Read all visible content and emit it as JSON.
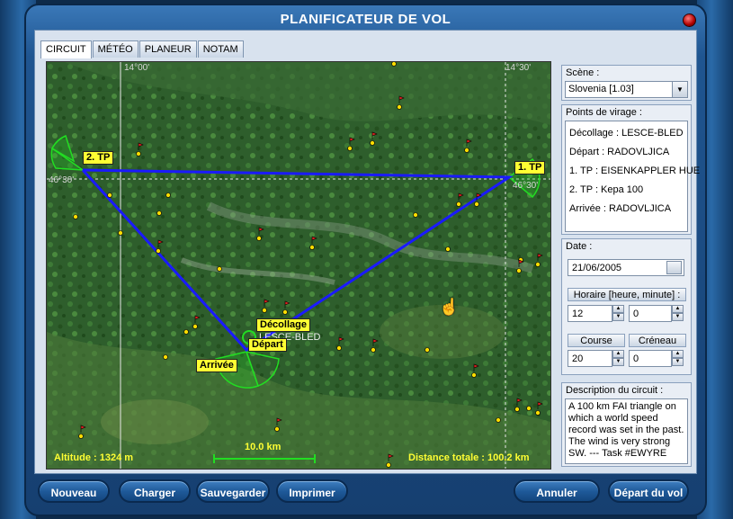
{
  "window": {
    "title": "PLANIFICATEUR DE VOL"
  },
  "tabs": [
    "CIRCUIT",
    "MÉTÉO",
    "PLANEUR",
    "NOTAM"
  ],
  "map": {
    "lon_left": "14°00'",
    "lon_right": "14°30'",
    "lat_left": "46°30'",
    "lat_right": "46°30'",
    "waypoint_2tp": "2. TP",
    "waypoint_1tp": "1. TP",
    "waypoint_takeoff": "Décollage",
    "waypoint_takeoff_name": "LESCE-BLED",
    "waypoint_start": "Départ",
    "waypoint_finish": "Arrivée",
    "altitude": "Altitude : 1324 m",
    "scale": "10.0 km",
    "total_distance": "Distance totale : 100.2 km",
    "route_color": "#1a1aff",
    "sector_color": "#22dd22"
  },
  "scene": {
    "label": "Scène :",
    "value": "Slovenia [1.03]"
  },
  "turnpoints": {
    "label": "Points de virage :",
    "items": [
      "Décollage : LESCE-BLED",
      "Départ : RADOVLJICA",
      "1. TP : EISENKAPPLER HUE",
      "2. TP : Kepa 100",
      "Arrivée : RADOVLJICA"
    ]
  },
  "date": {
    "label": "Date :",
    "value": "21/06/2005",
    "time_label": "Horaire [heure, minute] :",
    "hour": "12",
    "minute": "0",
    "course_label": "Course dans",
    "course_value": "20",
    "slot_label": "Créneau",
    "slot_value": "0"
  },
  "description": {
    "label": "Description du circuit :",
    "text": "A 100 km FAI triangle on which a world speed record was set in the past. The wind is very strong SW. --- Task #EWYRE"
  },
  "buttons": {
    "new": "Nouveau",
    "load": "Charger",
    "save": "Sauvegarder",
    "print": "Imprimer",
    "cancel": "Annuler",
    "start": "Départ du vol"
  }
}
